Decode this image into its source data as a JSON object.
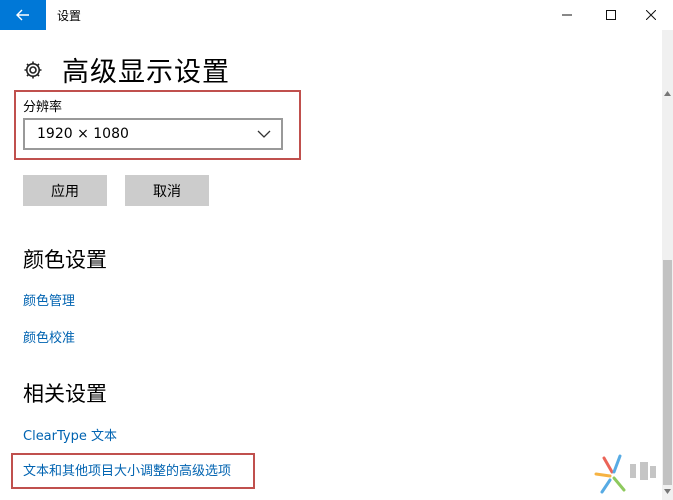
{
  "window": {
    "title": "设置",
    "back_icon": "arrow-left-icon",
    "controls": [
      "minimize-icon",
      "maximize-icon",
      "close-icon"
    ]
  },
  "header": {
    "icon": "gear-icon",
    "title": "高级显示设置"
  },
  "resolution": {
    "label": "分辨率",
    "selected": "1920 × 1080",
    "chevron_icon": "chevron-down-icon"
  },
  "actions": {
    "apply_label": "应用",
    "cancel_label": "取消"
  },
  "color_settings": {
    "heading": "颜色设置",
    "links": [
      "颜色管理",
      "颜色校准"
    ]
  },
  "related_settings": {
    "heading": "相关设置",
    "links": [
      "ClearType 文本",
      "文本和其他项目大小调整的高级选项"
    ]
  },
  "colors": {
    "accent": "#0078d7",
    "link": "#0063b1",
    "button_bg": "#cccccc",
    "highlight": "#c0504d"
  }
}
